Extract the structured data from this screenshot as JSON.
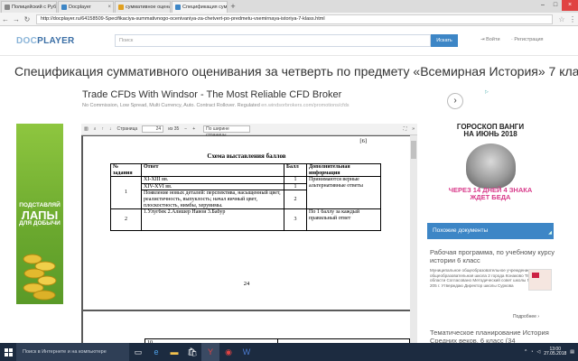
{
  "browser": {
    "tabs": [
      {
        "label": "Полицейский с Рублевки"
      },
      {
        "label": "Docplayer"
      },
      {
        "label": "суммативное оценивани"
      },
      {
        "label": "Спецификация суммати"
      }
    ],
    "active_tab": 3,
    "new_tab": "+",
    "url": "http://docplayer.ru/64158509-Specifikaciya-summativnogo-ocenivaniya-za-chetvert-po-predmetu-vsemirnaya-istoriya-7-klass.html"
  },
  "site": {
    "logo_light": "DOC",
    "logo_dark": "PLAYER",
    "search_placeholder": "Поиск",
    "search_button": "Искать",
    "login": "Войти",
    "register": "Регистрация"
  },
  "page_title": "Спецификация суммативного оценивания за четверть по предмету «Всемирная История» 7 класс",
  "ad": {
    "title": "Trade CFDs With Windsor - The Most Reliable CFD Broker",
    "subtitle": "No Commission, Low Spread, Multi Currency, Auto. Contract Rollover. Regulated",
    "source": "en.windsorbrokers.com/promotions/cfds",
    "choices": "▷"
  },
  "left_ad": {
    "line1": "ПОДСТАВЛЯЙ",
    "line2": "ЛАПЫ",
    "line3": "ДЛЯ ДОБЫЧИ"
  },
  "viewer": {
    "page_label": "Страница",
    "page_value": "24",
    "page_of": "из 35",
    "zoom": "По ширине страницы",
    "page_number_bracket": "[6]",
    "schema_title": "Схема выставления баллов",
    "table_headers": [
      "№ задания",
      "Ответ",
      "Балл",
      "Дополнительная информация"
    ],
    "rows": [
      {
        "num": "1",
        "answers": [
          "XI-XIII вв.",
          "XIV-XVI вв.",
          "Появление новых деталей: перспектива, насыщенный цвет, реалистичность, выпуклость; начал яичный цвет, плоскостность, нимбы, херувимы."
        ],
        "scores": [
          "1",
          "1",
          "2"
        ],
        "info": "Принимаются верные альтернативные ответы"
      },
      {
        "num": "2",
        "answers": [
          "1.Улугбек 2.Алишер Навои 3.Бабур"
        ],
        "scores": [
          "3"
        ],
        "info": "По 1 баллу за каждый правильный ответ"
      }
    ],
    "footer_page": "24",
    "page2_cell": "10"
  },
  "right_ad": {
    "title_line1": "ГОРОСКОП ВАНГИ",
    "title_line2": "НА ИЮНЬ 2018",
    "bottom_line1": "ЧЕРЕЗ 14 ДНЕЙ 4 ЗНАКА",
    "bottom_line2": "ЖДЕТ БЕДА"
  },
  "similar": {
    "heading": "Похожие документы",
    "doc1_title": "Рабочая программа, по учебному курсу истории 6 класс",
    "doc1_text": "Муниципальное общеобразовательное учреждение средняя общеобразовательная школа 2 города Конаково Тверской области Согласовано Методический совет школы Протокол от 205 г. Утверждаю Директор школы Суркова",
    "more": "Подробнее",
    "doc2_title": "Тематическое планирование История Средних веков, 6 класс (34"
  },
  "taskbar": {
    "search_placeholder": "Поиск в Интернете и на компьютере",
    "time": "13:00",
    "date": "27.05.2018"
  }
}
